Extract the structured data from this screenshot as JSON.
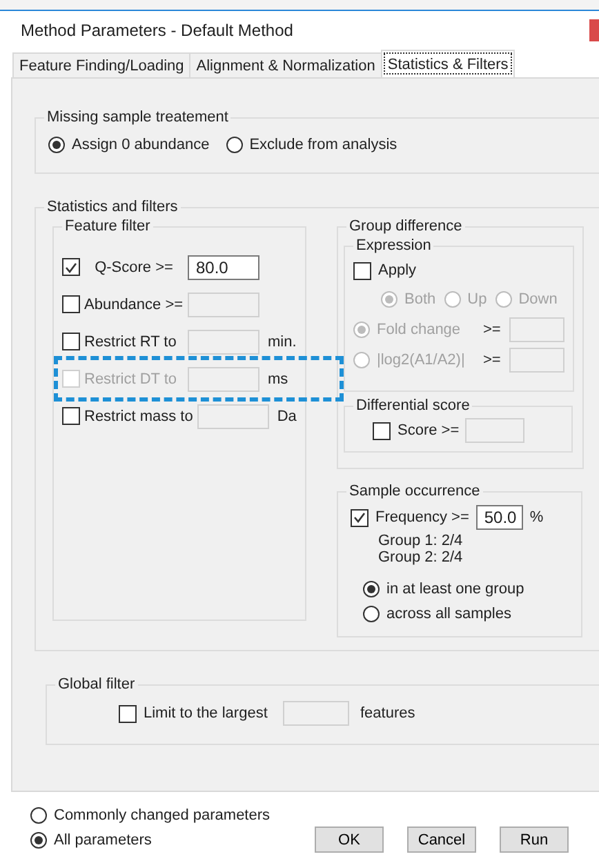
{
  "window": {
    "title": "Method Parameters - Default Method"
  },
  "tabs": [
    {
      "label": "Feature Finding/Loading",
      "selected": false
    },
    {
      "label": "Alignment & Normalization",
      "selected": false
    },
    {
      "label": "Statistics & Filters",
      "selected": true
    }
  ],
  "missing_sample": {
    "title": "Missing sample treatement",
    "options": [
      {
        "label": "Assign 0 abundance",
        "selected": true
      },
      {
        "label": "Exclude from analysis",
        "selected": false
      }
    ]
  },
  "statistics": {
    "title": "Statistics and filters",
    "feature_filter": {
      "title": "Feature filter",
      "rows": [
        {
          "label": "Q-Score >=",
          "checked": true,
          "disabled": false,
          "highlighted": false,
          "value": "80.0"
        },
        {
          "label": "Abundance >=",
          "checked": false,
          "disabled": false,
          "highlighted": false
        },
        {
          "label": "Restrict RT to",
          "checked": false,
          "disabled": false,
          "highlighted": false,
          "unit": "min."
        },
        {
          "label": "Restrict DT to",
          "checked": false,
          "disabled": true,
          "highlighted": true,
          "unit": "ms"
        },
        {
          "label": "Restrict mass to",
          "checked": false,
          "disabled": false,
          "highlighted": false,
          "unit": "Da"
        }
      ]
    },
    "group_difference": {
      "title": "Group difference",
      "expression": {
        "title": "Expression",
        "apply": {
          "label": "Apply",
          "checked": false
        },
        "disabled": true,
        "direction": [
          {
            "label": "Both",
            "selected": true
          },
          {
            "label": "Up",
            "selected": false
          },
          {
            "label": "Down",
            "selected": false
          }
        ],
        "measures": [
          {
            "label": "Fold change",
            "selected": true,
            "operator": ">="
          },
          {
            "label": "|log2(A1/A2)|",
            "selected": false,
            "operator": ">="
          }
        ]
      },
      "differential_score": {
        "title": "Differential score",
        "label": "Score >=",
        "checked": false
      }
    },
    "sample_occurrence": {
      "title": "Sample occurrence",
      "frequency": {
        "label": "Frequency >=",
        "checked": true,
        "value": "50.0",
        "unit": "%"
      },
      "groups": [
        "Group 1: 2/4",
        "Group 2: 2/4"
      ],
      "options": [
        {
          "label": "in at least one group",
          "selected": true
        },
        {
          "label": "across all samples",
          "selected": false
        }
      ]
    }
  },
  "global_filter": {
    "title": "Global filter",
    "label": "Limit to the largest",
    "checked": false,
    "unit": "features"
  },
  "parameter_view": [
    {
      "label": "Commonly changed parameters",
      "selected": false
    },
    {
      "label": "All parameters",
      "selected": true
    }
  ],
  "buttons": [
    "OK",
    "Cancel",
    "Run"
  ]
}
